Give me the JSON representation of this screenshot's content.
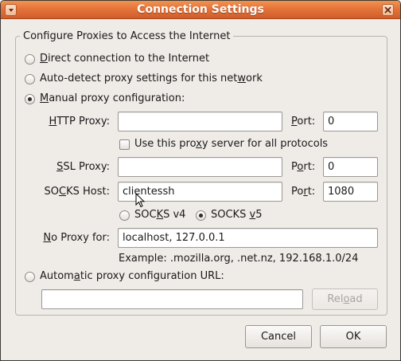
{
  "window": {
    "title": "Connection Settings"
  },
  "frame": {
    "legend": "Configure Proxies to Access the Internet"
  },
  "proxy_modes": [
    {
      "label_pre": "",
      "mnemonic": "D",
      "label_post": "irect connection to the Internet",
      "checked": false
    },
    {
      "label_pre": "Auto-detect proxy settings for this net",
      "mnemonic": "w",
      "label_post": "ork",
      "checked": false
    },
    {
      "label_pre": "",
      "mnemonic": "M",
      "label_post": "anual proxy configuration:",
      "checked": true
    },
    {
      "label_pre": "Autom",
      "mnemonic": "a",
      "label_post": "tic proxy configuration URL:",
      "checked": false
    }
  ],
  "http": {
    "label_pre": "",
    "mnemonic": "H",
    "label_post": "TTP Proxy:",
    "value": "",
    "port_pre": "",
    "port_mnemonic": "P",
    "port_post": "ort:",
    "port": "0"
  },
  "use_all": {
    "label_pre": "Use this pro",
    "mnemonic": "x",
    "label_post": "y server for all protocols",
    "checked": false
  },
  "ssl": {
    "label_pre": "",
    "mnemonic": "S",
    "label_post": "SL Proxy:",
    "value": "",
    "port_pre": "P",
    "port_mnemonic": "o",
    "port_post": "rt:",
    "port": "0"
  },
  "socks": {
    "label_pre": "SO",
    "mnemonic": "C",
    "label_post": "KS Host:",
    "value": "clientessh",
    "port_pre": "Po",
    "port_mnemonic": "r",
    "port_post": "t:",
    "port": "1080"
  },
  "socks_version": [
    {
      "label_pre": "SOC",
      "mnemonic": "K",
      "label_post": "S v4",
      "checked": false
    },
    {
      "label_pre": "SOCKS ",
      "mnemonic": "v",
      "label_post": "5",
      "checked": true
    }
  ],
  "no_proxy": {
    "label_pre": "",
    "mnemonic": "N",
    "label_post": "o Proxy for:",
    "value": "localhost, 127.0.0.1",
    "example": "Example: .mozilla.org, .net.nz, 192.168.1.0/24"
  },
  "auto_url": {
    "value": "",
    "reload_pre": "Rel",
    "reload_mnemonic": "o",
    "reload_post": "ad"
  },
  "footer": {
    "cancel": "Cancel",
    "ok": "OK"
  }
}
